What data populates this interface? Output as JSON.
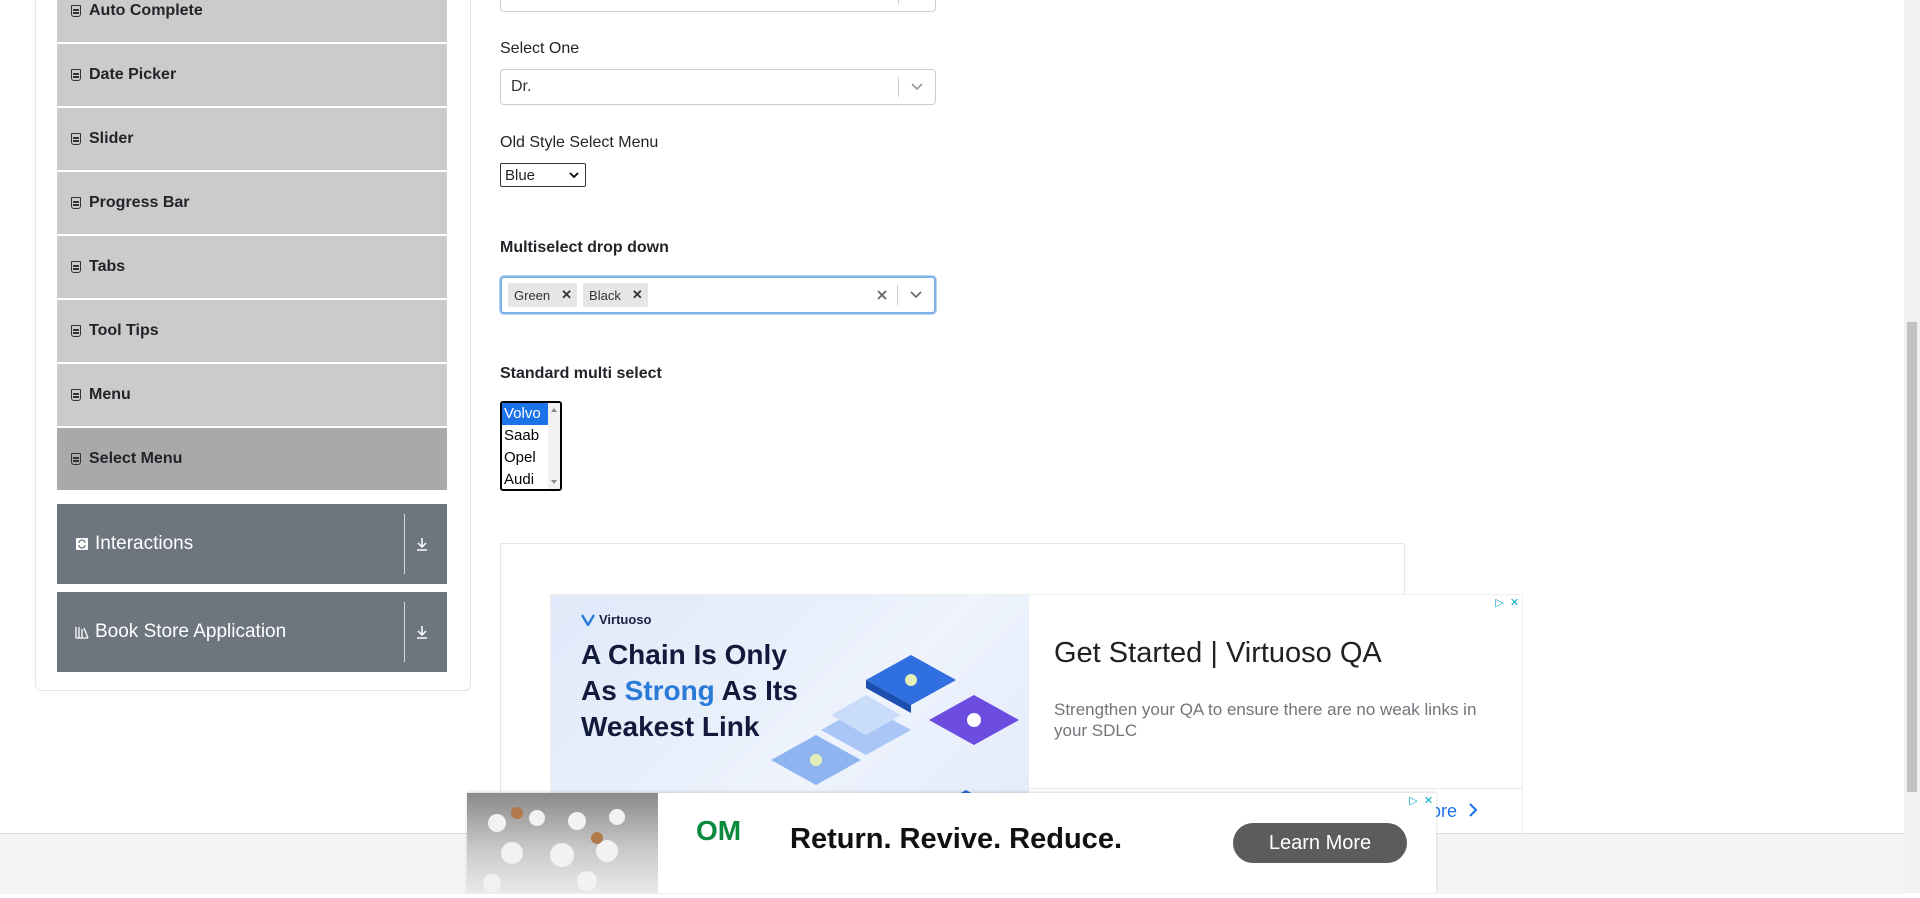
{
  "sidebar": {
    "elements_items": [
      {
        "label": "Auto Complete",
        "active": false
      },
      {
        "label": "Date Picker",
        "active": false
      },
      {
        "label": "Slider",
        "active": false
      },
      {
        "label": "Progress Bar",
        "active": false
      },
      {
        "label": "Tabs",
        "active": false
      },
      {
        "label": "Tool Tips",
        "active": false
      },
      {
        "label": "Menu",
        "active": false
      },
      {
        "label": "Select Menu",
        "active": true
      }
    ],
    "groups": [
      {
        "label": "Interactions",
        "icon": "interactions-icon"
      },
      {
        "label": "Book Store Application",
        "icon": "book-store-icon"
      }
    ]
  },
  "main": {
    "select_one": {
      "label": "Select One",
      "value": "Dr."
    },
    "old_style": {
      "label": "Old Style Select Menu",
      "value": "Blue"
    },
    "multiselect": {
      "label": "Multiselect drop down",
      "tags": [
        "Green",
        "Black"
      ]
    },
    "standard_multi": {
      "label": "Standard multi select",
      "options": [
        "Volvo",
        "Saab",
        "Opel",
        "Audi"
      ],
      "selected": "Volvo"
    }
  },
  "ads": {
    "ad1": {
      "brand": "Virtuoso",
      "headline_line1": "A Chain Is Only",
      "headline_line2_pre": "As ",
      "headline_line2_strong": "Strong",
      "headline_line2_post": " As Its",
      "headline_line3": "Weakest Link",
      "title": "Get Started | Virtuoso QA",
      "description": "Strengthen your QA to ensure there are no weak links in your SDLC",
      "more": "ore"
    },
    "ad2": {
      "logo": "OM",
      "text": "Return. Revive. Reduce.",
      "button": "Learn More"
    }
  },
  "colors": {
    "menu_item_bg": "#cbcbcb",
    "menu_item_active_bg": "#a9a9a9",
    "group_header_bg": "#6d757e",
    "accent_blue": "#1a73e8"
  }
}
